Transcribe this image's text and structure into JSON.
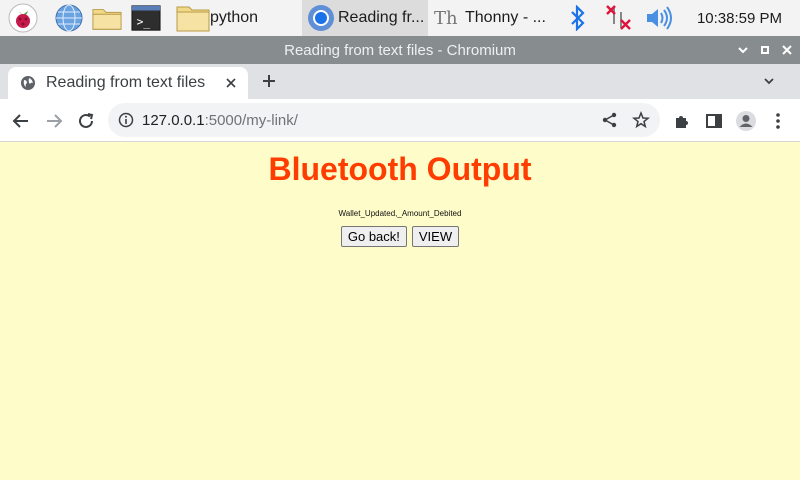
{
  "taskbar": {
    "items": [
      {
        "icon": "raspberry-pi-menu-icon"
      },
      {
        "icon": "globe-browser-icon"
      },
      {
        "icon": "folder-icon"
      },
      {
        "icon": "terminal-icon",
        "glyph": ">_"
      },
      {
        "icon": "folder-icon",
        "label": "python"
      },
      {
        "icon": "chromium-icon",
        "label": "Reading fr..."
      },
      {
        "icon": "thonny-icon",
        "glyph": "Th",
        "label": "Thonny  -  ..."
      }
    ],
    "tray": [
      "bluetooth-icon",
      "network-disconnected-icon",
      "volume-icon"
    ],
    "clock": "10:38:59 PM"
  },
  "window": {
    "title": "Reading from text files - Chromium"
  },
  "browser": {
    "tab": {
      "label": "Reading from text files"
    },
    "url_host": "127.0.0.1",
    "url_rest": ":5000/my-link/"
  },
  "page": {
    "heading": "Bluetooth Output",
    "message": "Wallet_Updated,_Amount_Debited",
    "go_back_label": "Go back!",
    "view_label": "VIEW"
  },
  "colors": {
    "page_bg": "#fefcc8",
    "heading": "#ff3d00",
    "titlebar": "#878c8f",
    "bluetooth": "#1a73e8"
  }
}
